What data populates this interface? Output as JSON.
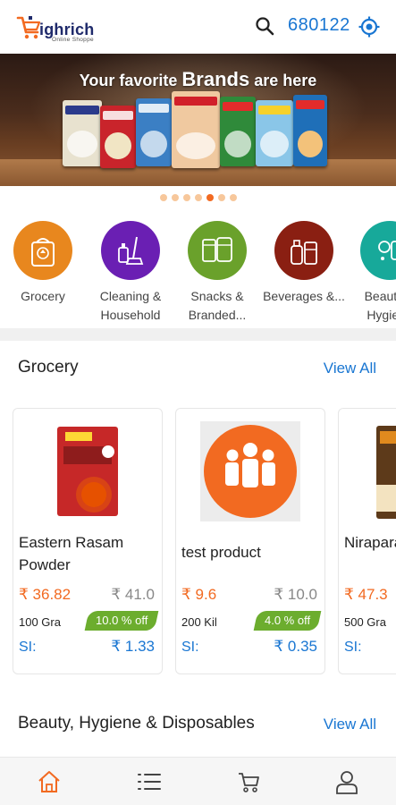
{
  "header": {
    "logo_text": "ighrich",
    "logo_tagline": "Online Shoppe",
    "pincode": "680122",
    "icons": {
      "search": "search-icon",
      "location": "location-target-icon"
    }
  },
  "banner": {
    "title_prefix": "Your favorite ",
    "title_emphasis": "Brands",
    "title_suffix": " are here"
  },
  "carousel": {
    "count": 7,
    "active_index": 4,
    "active_color": "#f26a21",
    "inactive_color": "#f7c79b"
  },
  "categories": [
    {
      "label": "Grocery",
      "color": "#e8871e",
      "icon": "grocery-bag-icon"
    },
    {
      "label": "Cleaning & Household",
      "color": "#6a1fb3",
      "icon": "cleaning-icon"
    },
    {
      "label": "Snacks & Branded...",
      "color": "#6aa12b",
      "icon": "snacks-icon"
    },
    {
      "label": "Beverages &...",
      "color": "#8a1f12",
      "icon": "beverages-icon"
    },
    {
      "label": "Beauty & Hygiene",
      "color": "#17a99a",
      "icon": "beauty-icon"
    }
  ],
  "sections": {
    "grocery": {
      "title": "Grocery",
      "view_all": "View All"
    },
    "beauty": {
      "title": "Beauty, Hygiene & Disposables",
      "view_all": "View All"
    }
  },
  "products": [
    {
      "name": "Eastern Rasam Powder",
      "price": "₹ 36.82",
      "mrp": "₹ 41.0",
      "qty": "100 Gra",
      "discount": "10.0 % off",
      "si_label": "SI:",
      "saving": "₹ 1.33"
    },
    {
      "name": "test product",
      "price": "₹ 9.6",
      "mrp": "₹ 10.0",
      "qty": "200 Kil",
      "discount": "4.0 % off",
      "si_label": "SI:",
      "saving": "₹ 0.35"
    },
    {
      "name": "Nirapara Puttu P",
      "price": "₹ 47.3",
      "mrp": "",
      "qty": "500 Gra",
      "discount": "",
      "si_label": "SI:",
      "saving": ""
    }
  ],
  "bottom_nav": [
    {
      "icon": "home-icon",
      "active": true
    },
    {
      "icon": "list-icon",
      "active": false
    },
    {
      "icon": "cart-icon",
      "active": false
    },
    {
      "icon": "profile-icon",
      "active": false
    }
  ],
  "colors": {
    "accent": "#f26a21",
    "link": "#1976d2",
    "discount": "#6cad2e"
  }
}
